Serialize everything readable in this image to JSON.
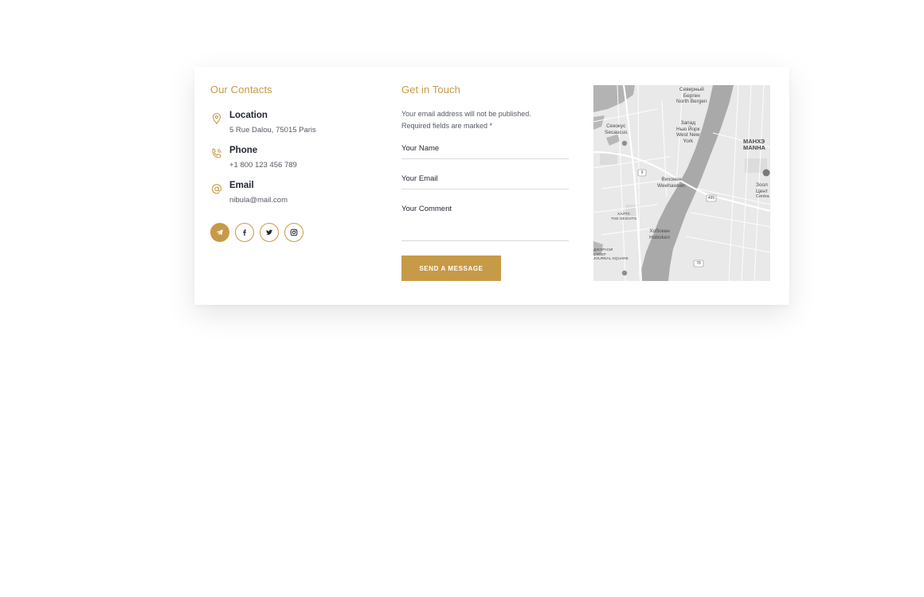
{
  "contacts": {
    "title": "Our Contacts",
    "items": [
      {
        "label": "Location",
        "value": "5 Rue Dalou, 75015 Paris",
        "icon": "map-pin-icon"
      },
      {
        "label": "Phone",
        "value": "+1 800 123 456 789",
        "icon": "phone-icon"
      },
      {
        "label": "Email",
        "value": "nibula@mail.com",
        "icon": "at-sign-icon"
      }
    ],
    "socials": [
      "telegram-icon",
      "facebook-icon",
      "twitter-icon",
      "instagram-icon"
    ]
  },
  "form": {
    "title": "Get in Touch",
    "note_line1": "Your email address will not be published.",
    "note_line2": "Required fields are marked *",
    "name_label": "Your Name",
    "email_label": "Your Email",
    "comment_label": "Your Comment",
    "submit_label": "SEND A MESSAGE"
  },
  "map": {
    "labels": {
      "north_bergen_ru_1": "Северный",
      "north_bergen_ru_2": "Берген",
      "north_bergen_en": "North Bergen",
      "secaucus_ru": "Секокус",
      "secaucus_en": "Secaucus",
      "wny_ru_1": "Запад",
      "wny_ru_2": "Нью Йорк",
      "wny_en_1": "West New",
      "wny_en_2": "York",
      "manhattan_ru": "МАНХЭ",
      "manhattan_en": "MANHA",
      "weehawken_ru": "Вихокен",
      "weehawken_en": "Weehawken",
      "hoboken_ru": "Хобокен",
      "hoboken_en": "Hoboken",
      "heights_ru": "ХАЙТС",
      "heights_en": "THE HEIGHTS",
      "journal_ru_1": "ДЖОРНЭЛ",
      "journal_ru_2": "СКВЕР",
      "journal_en": "JOURNAL SQUARE",
      "central_ru_1": "Зоол",
      "central_ru_2": "Цент",
      "central_en": "Centra",
      "highway_1": "9",
      "highway_2": "495",
      "highway_3": "78"
    }
  },
  "colors": {
    "accent": "#c79a47",
    "text": "#1f2430",
    "muted": "#555a63"
  }
}
